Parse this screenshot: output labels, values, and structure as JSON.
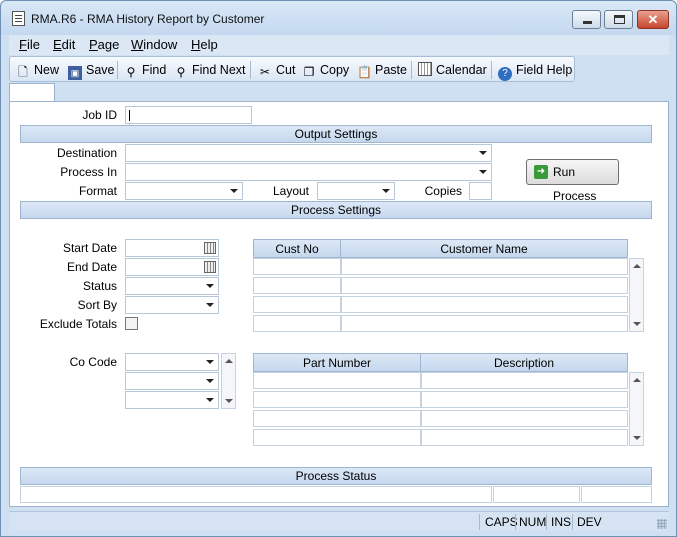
{
  "window": {
    "title": "RMA.R6 - RMA History Report by Customer"
  },
  "menu": [
    {
      "label": "File",
      "key": "F",
      "rest": "ile"
    },
    {
      "label": "Edit",
      "key": "E",
      "rest": "dit"
    },
    {
      "label": "Page",
      "key": "P",
      "rest": "age"
    },
    {
      "label": "Window",
      "key": "W",
      "rest": "indow"
    },
    {
      "label": "Help",
      "key": "H",
      "rest": "elp"
    }
  ],
  "toolbar": {
    "new": "New",
    "save": "Save",
    "find": "Find",
    "find_next": "Find Next",
    "cut": "Cut",
    "copy": "Copy",
    "paste": "Paste",
    "calendar": "Calendar",
    "field_help": "Field Help"
  },
  "form": {
    "job_id_label": "Job ID",
    "output_settings": "Output Settings",
    "destination_label": "Destination",
    "process_in_label": "Process In",
    "format_label": "Format",
    "layout_label": "Layout",
    "copies_label": "Copies",
    "run_process": "Run Process",
    "process_settings": "Process Settings",
    "start_date_label": "Start Date",
    "end_date_label": "End Date",
    "status_label": "Status",
    "sort_by_label": "Sort By",
    "exclude_totals_label": "Exclude Totals",
    "co_code_label": "Co Code",
    "process_status": "Process Status"
  },
  "customer_grid": {
    "headers": [
      "Cust No",
      "Customer Name"
    ]
  },
  "part_grid": {
    "headers": [
      "Part Number",
      "Description"
    ]
  },
  "statusbar": {
    "caps": "CAPS",
    "num": "NUM",
    "ins": "INS",
    "dev": "DEV"
  }
}
